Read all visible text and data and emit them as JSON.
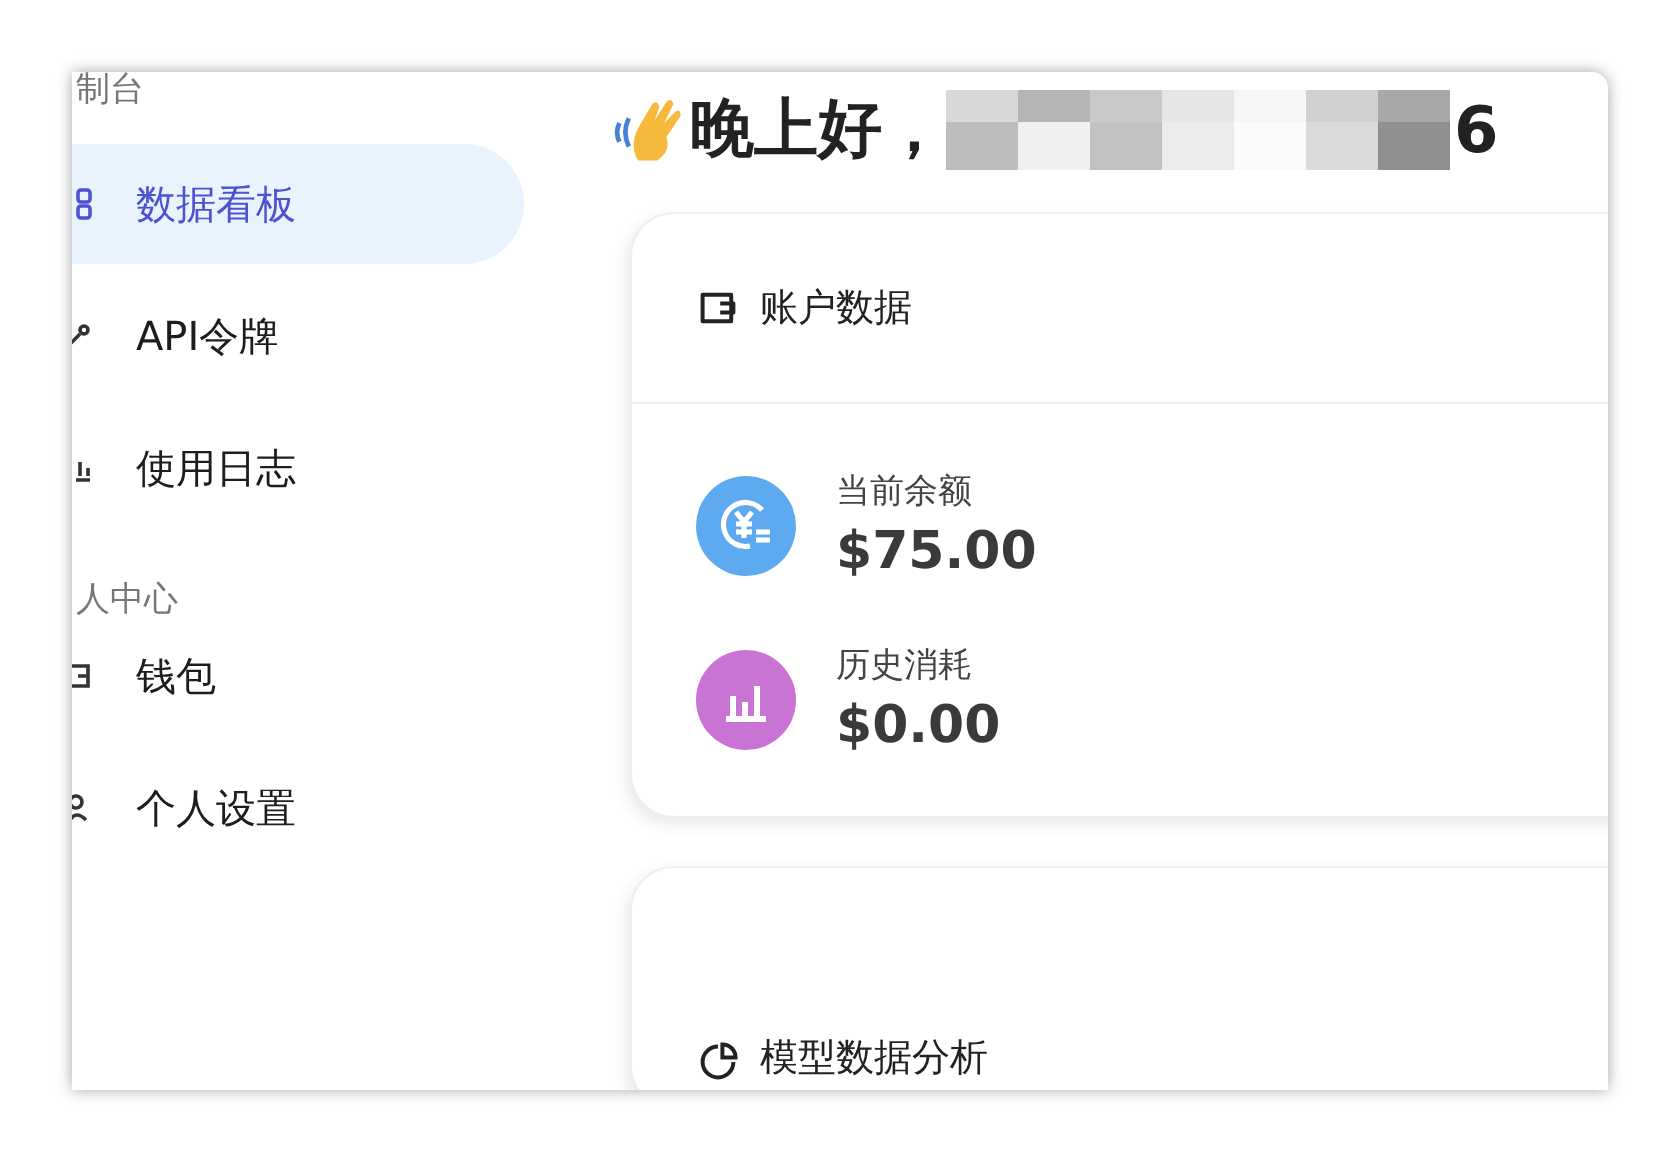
{
  "sidebar": {
    "sections": [
      {
        "title": "制台",
        "items": [
          {
            "kind": "grid",
            "label": "数据看板",
            "selected": true
          },
          {
            "kind": "key",
            "label": "API令牌",
            "selected": false
          },
          {
            "kind": "chart",
            "label": "使用日志",
            "selected": false
          }
        ]
      },
      {
        "title": "人中心",
        "items": [
          {
            "kind": "wallet",
            "label": "钱包",
            "selected": false
          },
          {
            "kind": "user",
            "label": "个人设置",
            "selected": false
          }
        ]
      }
    ]
  },
  "greeting": {
    "text": "晚上好，",
    "name_tail": "6"
  },
  "account_card": {
    "title": "账户数据",
    "stats": [
      {
        "kind": "balance",
        "color": "#5eaaf0",
        "label": "当前余额",
        "value": "$75.00"
      },
      {
        "kind": "usage",
        "color": "#c974d4",
        "label": "历史消耗",
        "value": "$0.00"
      }
    ]
  },
  "model_card": {
    "title": "模型数据分析"
  }
}
